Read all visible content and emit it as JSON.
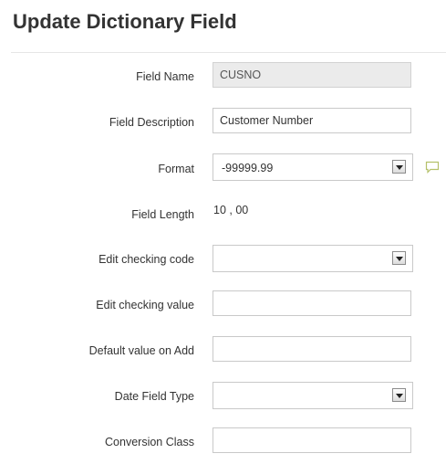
{
  "page": {
    "title": "Update Dictionary Field"
  },
  "form": {
    "field_name": {
      "label": "Field Name",
      "value": "CUSNO"
    },
    "field_description": {
      "label": "Field Description",
      "value": "Customer Number"
    },
    "format": {
      "label": "Format",
      "selected": "-99999.99",
      "note_icon": "comment-icon"
    },
    "field_length": {
      "label": "Field Length",
      "value": "10 , 00"
    },
    "edit_checking_code": {
      "label": "Edit checking code",
      "selected": ""
    },
    "edit_checking_value": {
      "label": "Edit checking value",
      "value": ""
    },
    "default_value_on_add": {
      "label": "Default value on Add",
      "value": ""
    },
    "date_field_type": {
      "label": "Date Field Type",
      "selected": ""
    },
    "conversion_class": {
      "label": "Conversion Class",
      "value": ""
    }
  },
  "colors": {
    "accent_icon": "#b5c16a",
    "input_border": "#c9c9c9",
    "readonly_bg": "#ebebeb"
  }
}
